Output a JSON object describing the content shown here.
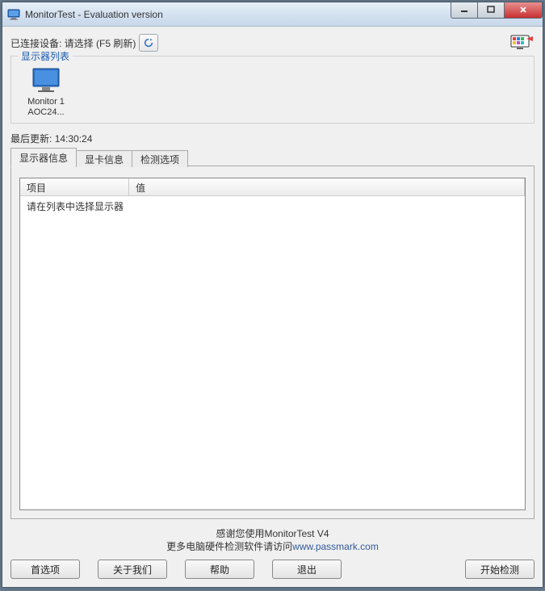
{
  "window": {
    "title": "MonitorTest - Evaluation version"
  },
  "toolbar": {
    "connected_label": "已连接设备: 请选择 (F5 刷新)"
  },
  "monitor_group": {
    "title": "显示器列表",
    "items": [
      {
        "line1": "Monitor 1",
        "line2": "AOC24..."
      }
    ]
  },
  "last_update": {
    "label": "最后更新:",
    "value": "14:30:24"
  },
  "tabs": [
    {
      "label": "显示器信息",
      "active": true
    },
    {
      "label": "显卡信息",
      "active": false
    },
    {
      "label": "检测选项",
      "active": false
    }
  ],
  "table": {
    "columns": [
      "项目",
      "值"
    ],
    "message": "请在列表中选择显示器"
  },
  "footer": {
    "line1": "感谢您使用MonitorTest V4",
    "line2_pre": "更多电脑硬件检测软件请访问",
    "line2_link": "www.passmark.com"
  },
  "buttons": {
    "prefs": "首选项",
    "about": "关于我们",
    "help": "帮助",
    "exit": "退出",
    "start": "开始检测"
  }
}
